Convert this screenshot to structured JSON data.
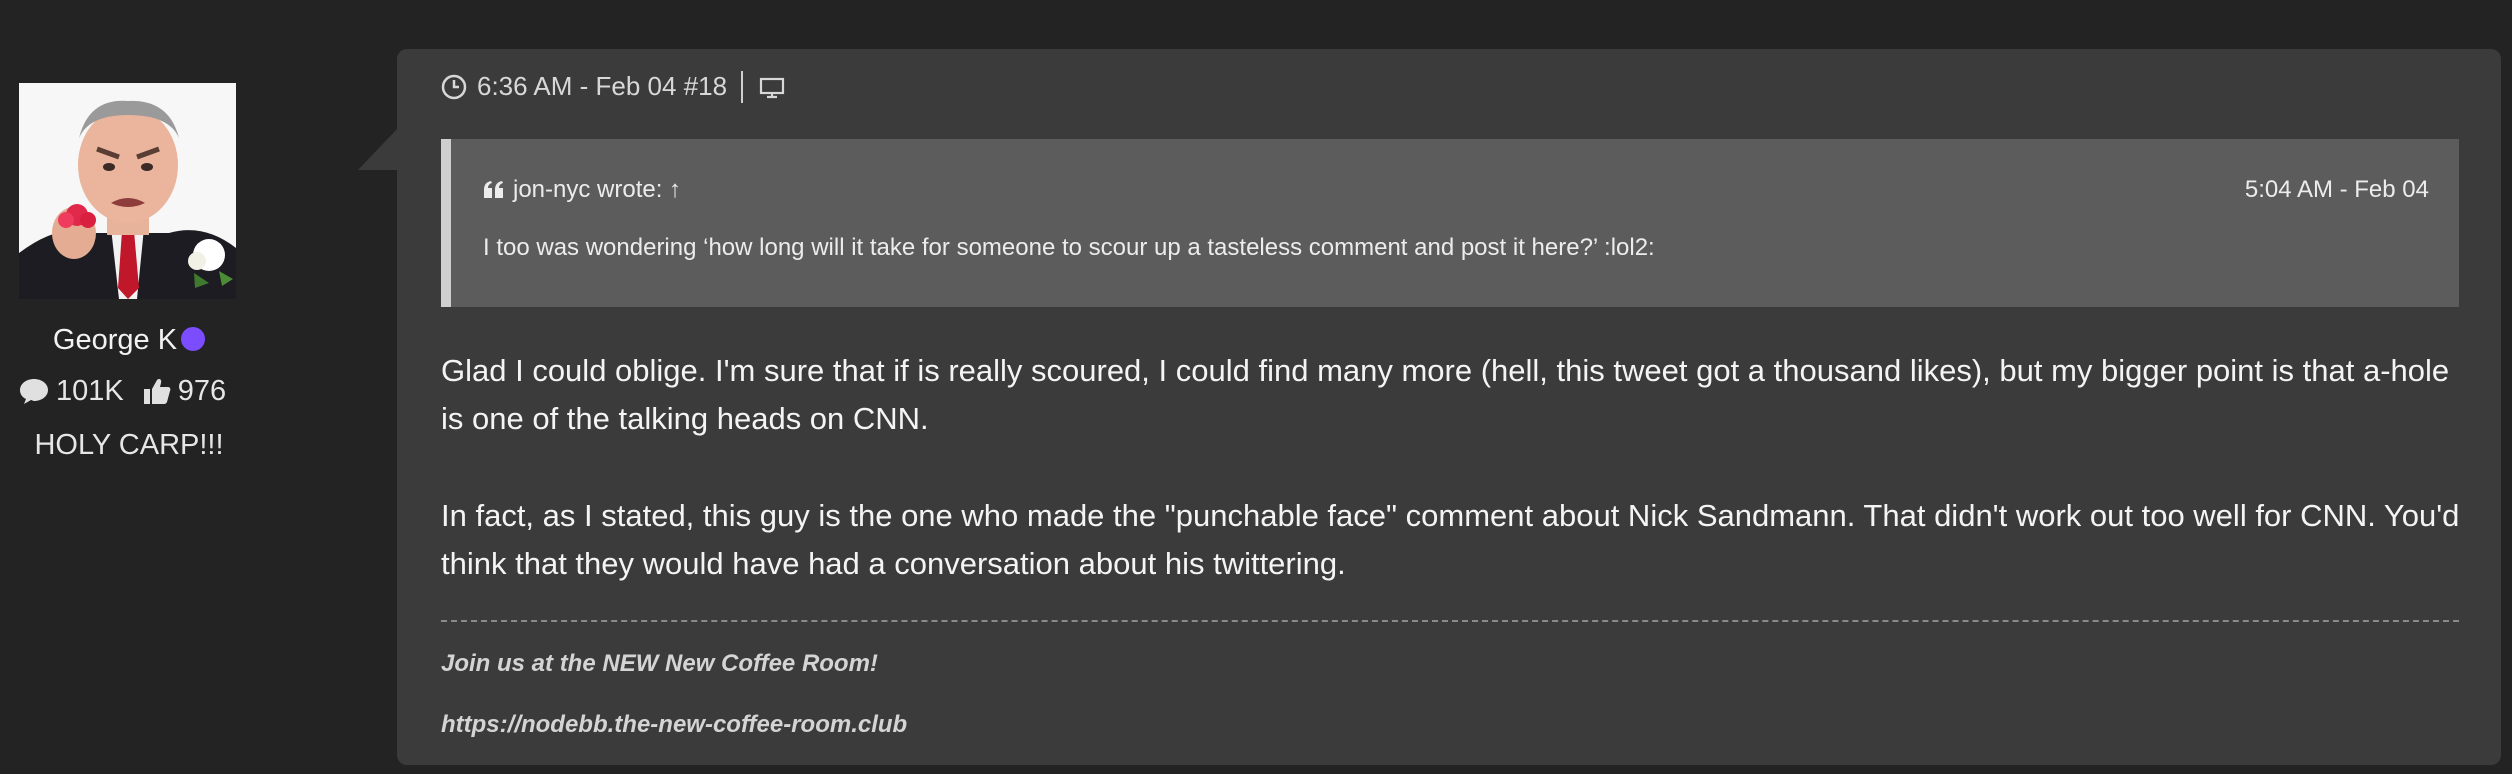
{
  "user": {
    "name": "George K",
    "post_count": "101K",
    "reputation": "976",
    "title": "HOLY CARP!!!",
    "status_color": "#7b4dff"
  },
  "post": {
    "timestamp": "6:36 AM - Feb 04",
    "post_number": "#18",
    "quote": {
      "author_line": "jon-nyc wrote: ↑",
      "time": "5:04 AM - Feb 04",
      "text": "I too was wondering ‘how long will it take for someone to scour up a tasteless comment and post it here?’    :lol2:"
    },
    "body": [
      "Glad I could oblige. I'm sure that if is really scoured, I could find many more (hell, this tweet got a thousand likes), but my bigger point is that a-hole is one of the talking heads on CNN.",
      "In fact, as I stated, this guy is the one who made the \"punchable face\" comment about Nick Sandmann. That didn't work out too well for CNN. You'd think that they would have had a conversation about his twittering."
    ],
    "signature": {
      "line1": "Join us at the NEW New Coffee Room!",
      "line2": "https://nodebb.the-new-coffee-room.club"
    }
  },
  "icons": {
    "clock": "clock-icon",
    "device": "desktop-icon",
    "quote": "quote-icon",
    "comment": "comment-icon",
    "thumbs_up": "thumbs-up-icon"
  },
  "colors": {
    "page_bg": "#232323",
    "card_bg": "#3b3b3b",
    "quote_bg": "#5c5c5c",
    "quote_bar": "#cfcfcf"
  }
}
